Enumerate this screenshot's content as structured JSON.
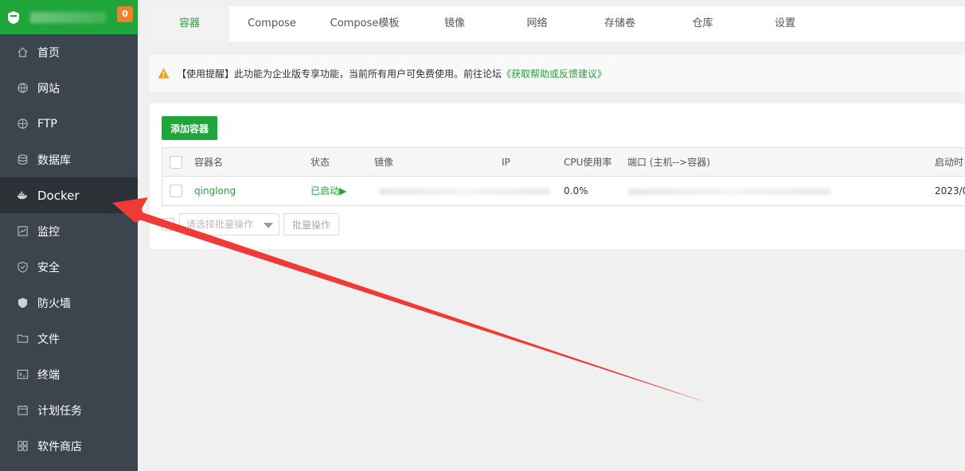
{
  "brand": {
    "badge": "0"
  },
  "sidebar": {
    "items": [
      {
        "label": "首页",
        "icon": "home-icon"
      },
      {
        "label": "网站",
        "icon": "globe-icon"
      },
      {
        "label": "FTP",
        "icon": "ftp-icon"
      },
      {
        "label": "数据库",
        "icon": "database-icon"
      },
      {
        "label": "Docker",
        "icon": "docker-icon"
      },
      {
        "label": "监控",
        "icon": "monitor-icon"
      },
      {
        "label": "安全",
        "icon": "shield-icon"
      },
      {
        "label": "防火墙",
        "icon": "firewall-icon"
      },
      {
        "label": "文件",
        "icon": "folder-icon"
      },
      {
        "label": "终端",
        "icon": "terminal-icon"
      },
      {
        "label": "计划任务",
        "icon": "calendar-icon"
      },
      {
        "label": "软件商店",
        "icon": "apps-icon"
      }
    ],
    "active": "Docker"
  },
  "tabs": [
    "容器",
    "Compose",
    "Compose模板",
    "镜像",
    "网络",
    "存储卷",
    "仓库",
    "设置"
  ],
  "notice": {
    "text": "【使用提醒】此功能为企业版专享功能，当前所有用户可免费使用。前往论坛",
    "link": "《获取帮助或反馈建议》"
  },
  "toolbar": {
    "add_label": "添加容器"
  },
  "table": {
    "headers": {
      "name": "容器名",
      "status": "状态",
      "image": "镜像",
      "ip": "IP",
      "cpu": "CPU使用率",
      "ports": "端口 (主机-->容器)",
      "started": "启动时"
    },
    "rows": [
      {
        "name": "qinglong",
        "status": "已启动▶",
        "cpu": "0.0%",
        "started": "2023/0"
      }
    ]
  },
  "batch": {
    "placeholder": "请选择批量操作",
    "button": "批量操作"
  },
  "colors": {
    "brand": "#20a53a",
    "sidebar": "#3c444d",
    "badge": "#f0812c",
    "arrow": "#ef3b36"
  }
}
